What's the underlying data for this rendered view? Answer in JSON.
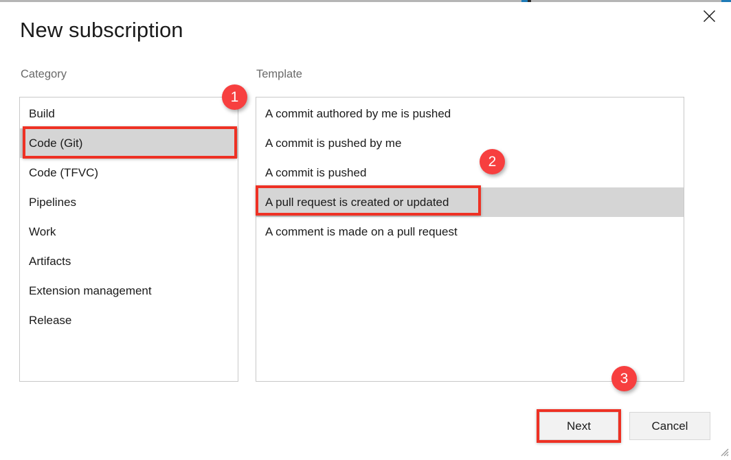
{
  "window": {
    "close_icon": "close-icon",
    "resize_grip_icon": "resize-grip-icon",
    "accent_color": "#1f7bb6"
  },
  "dialog": {
    "title": "New subscription"
  },
  "category": {
    "label": "Category",
    "items": [
      {
        "label": "Build",
        "selected": false
      },
      {
        "label": "Code (Git)",
        "selected": true
      },
      {
        "label": "Code (TFVC)",
        "selected": false
      },
      {
        "label": "Pipelines",
        "selected": false
      },
      {
        "label": "Work",
        "selected": false
      },
      {
        "label": "Artifacts",
        "selected": false
      },
      {
        "label": "Extension management",
        "selected": false
      },
      {
        "label": "Release",
        "selected": false
      }
    ]
  },
  "template": {
    "label": "Template",
    "items": [
      {
        "label": "A commit authored by me is pushed",
        "selected": false
      },
      {
        "label": "A commit is pushed by me",
        "selected": false
      },
      {
        "label": "A commit is pushed",
        "selected": false
      },
      {
        "label": "A pull request is created or updated",
        "selected": true
      },
      {
        "label": "A comment is made on a pull request",
        "selected": false
      }
    ]
  },
  "footer": {
    "next_label": "Next",
    "cancel_label": "Cancel"
  },
  "annotations": {
    "badge_color": "#f73f3f",
    "box_color": "#ee3124",
    "badges": [
      {
        "number": "1",
        "target": "category-item-code-git"
      },
      {
        "number": "2",
        "target": "template-item-pull-request"
      },
      {
        "number": "3",
        "target": "next-button"
      }
    ]
  }
}
